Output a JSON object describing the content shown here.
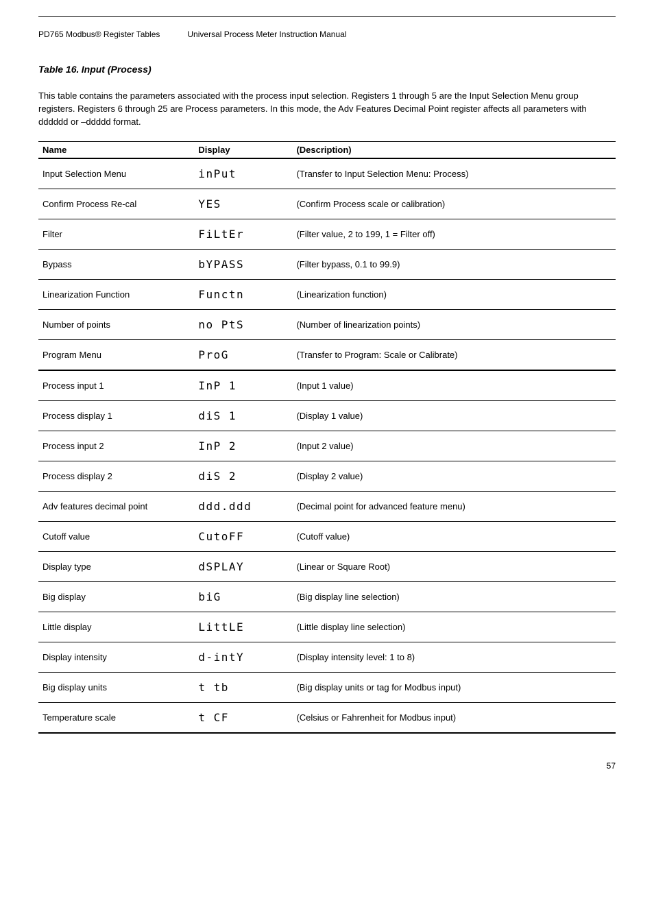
{
  "header": {
    "title": "PD765 Modbus® Register Tables",
    "subtitle": "Universal Process Meter Instruction Manual"
  },
  "section": {
    "number": "Table 16.",
    "title": "Input (Process)"
  },
  "intro": "This table contains the parameters associated with the process input selection. Registers 1 through 5 are the Input Selection Menu group registers. Registers 6 through 25 are Process parameters. In this mode, the Adv Features Decimal Point register affects all parameters with dddddd or –ddddd format.",
  "columns": {
    "name": "Name",
    "display": "Display",
    "description": "(Description)"
  },
  "rows": [
    {
      "name": "Input Selection Menu",
      "display": "inPut",
      "desc": "(Transfer to Input Selection Menu: Process)",
      "heavy": false
    },
    {
      "name": "Confirm Process Re-cal",
      "display": "YES",
      "desc": "(Confirm Process scale or calibration)",
      "heavy": false
    },
    {
      "name": "Filter",
      "display": "FiLtEr",
      "desc": "(Filter value, 2 to 199, 1 = Filter off)",
      "heavy": false
    },
    {
      "name": "Bypass",
      "display": "bYPASS",
      "desc": "(Filter bypass, 0.1 to 99.9)",
      "heavy": false
    },
    {
      "name": "Linearization Function",
      "display": "Functn",
      "desc": "(Linearization function)",
      "heavy": false
    },
    {
      "name": "Number of points",
      "display": "no PtS",
      "desc": "(Number of linearization points)",
      "heavy": false
    },
    {
      "name": "Program Menu",
      "display": "ProG",
      "desc": "(Transfer to Program: Scale or Calibrate)",
      "heavy": true
    },
    {
      "name": "Process input 1",
      "display": "InP  1",
      "desc": "(Input 1 value)",
      "heavy": false
    },
    {
      "name": "Process display 1",
      "display": "diS  1",
      "desc": "(Display 1 value)",
      "heavy": false
    },
    {
      "name": "Process input 2",
      "display": "InP  2",
      "desc": "(Input 2 value)",
      "heavy": false
    },
    {
      "name": "Process display 2",
      "display": "diS  2",
      "desc": "(Display 2 value)",
      "heavy": false
    },
    {
      "name": "Adv features decimal point",
      "display": "ddd.ddd",
      "desc": "(Decimal point for advanced feature menu)",
      "heavy": false
    },
    {
      "name": "Cutoff value",
      "display": "CutoFF",
      "desc": "(Cutoff value)",
      "heavy": false
    },
    {
      "name": "Display type",
      "display": "dSPLAY",
      "desc": "(Linear or Square Root)",
      "heavy": false
    },
    {
      "name": "Big display",
      "display": "biG",
      "desc": "(Big display line selection)",
      "heavy": false
    },
    {
      "name": "Little display",
      "display": "LittLE",
      "desc": "(Little display line selection)",
      "heavy": false
    },
    {
      "name": "Display intensity",
      "display": "d-intY",
      "desc": "(Display intensity level: 1 to 8)",
      "heavy": false
    },
    {
      "name": "Big display units",
      "display": "t tb",
      "desc": "(Big display units or tag for Modbus input)",
      "heavy": false
    },
    {
      "name": "Temperature scale",
      "display": "t CF",
      "desc": "(Celsius or Fahrenheit for Modbus input)",
      "heavy": true
    }
  ],
  "footer": {
    "page": "57"
  }
}
